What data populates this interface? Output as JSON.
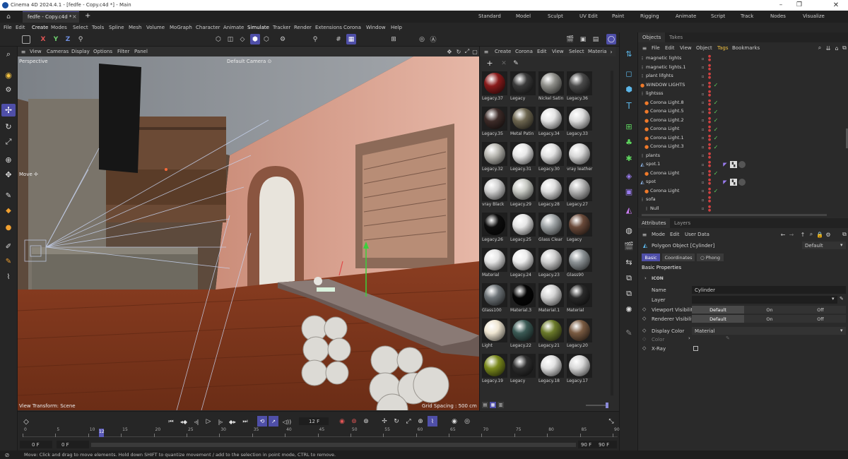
{
  "window": {
    "title": "Cinema 4D 2024.4.1 - [fedfe - Copy.c4d *] - Main"
  },
  "tabs": {
    "active": "fedfe - Copy.c4d *",
    "close": "×",
    "add": "+"
  },
  "layouts": [
    "Standard",
    "Model",
    "Sculpt",
    "UV Edit",
    "Paint",
    "Rigging",
    "Animate",
    "Script",
    "Track",
    "Nodes",
    "Visualize"
  ],
  "menu": [
    "File",
    "Edit",
    "Create",
    "Modes",
    "Select",
    "Tools",
    "Spline",
    "Mesh",
    "Volume",
    "MoGraph",
    "Character",
    "Animate",
    "Simulate",
    "Tracker",
    "Render",
    "Extensions",
    "Corona",
    "Window",
    "Help"
  ],
  "toolbar": {
    "x": "X",
    "y": "Y",
    "z": "Z"
  },
  "viewport": {
    "menu": [
      "View",
      "Cameras",
      "Display",
      "Options",
      "Filter",
      "Panel"
    ],
    "name": "Perspective",
    "camera": "Default Camera ⊙",
    "move_label": "Move ✢",
    "transform": "View Transform: Scene",
    "grid": "Grid Spacing : 500 cm"
  },
  "materials": {
    "menu": [
      "Create",
      "Corona",
      "Edit",
      "View",
      "Select",
      "Materia"
    ],
    "items": [
      {
        "label": "Legacy.37",
        "color": "#8a1b1b"
      },
      {
        "label": "Legacy",
        "color": "#3a3a3a"
      },
      {
        "label": "Nickel Satin",
        "color": "#8f8f8a"
      },
      {
        "label": "Legacy.36",
        "color": "#4a4a4a"
      },
      {
        "label": "Legacy.35",
        "color": "#3d2b28"
      },
      {
        "label": "Metal Patin",
        "color": "#6d6650"
      },
      {
        "label": "Legacy.34",
        "color": "#e4e4e4"
      },
      {
        "label": "Legacy.33",
        "color": "#dcdcdc"
      },
      {
        "label": "Legacy.32",
        "color": "#b9b8b2"
      },
      {
        "label": "Legacy.31",
        "color": "#e8e8e8"
      },
      {
        "label": "Legacy.30",
        "color": "#e2e2e2"
      },
      {
        "label": "vray leather",
        "color": "#d8d8d8"
      },
      {
        "label": "vray Black",
        "color": "#d0d0d0"
      },
      {
        "label": "Legacy.29",
        "color": "#c8cac4"
      },
      {
        "label": "Legacy.28",
        "color": "#dedede"
      },
      {
        "label": "Legacy.27",
        "color": "#b4b4b4"
      },
      {
        "label": "Legacy.26",
        "color": "#0d0d0d"
      },
      {
        "label": "Legacy.25",
        "color": "#e6e6e6"
      },
      {
        "label": "Glass Clear",
        "color": "#9fa4a6"
      },
      {
        "label": "Legacy",
        "color": "#6a4a3a"
      },
      {
        "label": "Material",
        "color": "#e4e4e4"
      },
      {
        "label": "Legacy.24",
        "color": "#ececec"
      },
      {
        "label": "Legacy.23",
        "color": "#cfcfcf"
      },
      {
        "label": "Glass90",
        "color": "#8d9396"
      },
      {
        "label": "Glass100",
        "color": "#6e7478"
      },
      {
        "label": "Material.3",
        "color": "#050505"
      },
      {
        "label": "Material.1",
        "color": "#d4d4d4"
      },
      {
        "label": "Material",
        "color": "#2a2a2a"
      },
      {
        "label": "Light",
        "color": "#efe6d2"
      },
      {
        "label": "Legacy.22",
        "color": "#3b5a55"
      },
      {
        "label": "Legacy.21",
        "color": "#6b7a2a"
      },
      {
        "label": "Legacy.20",
        "color": "#7a5b42"
      },
      {
        "label": "Legacy.19",
        "color": "#7b8a1d"
      },
      {
        "label": "Legacy",
        "color": "#2e2e2e"
      },
      {
        "label": "Legacy.18",
        "color": "#e2e2e2"
      },
      {
        "label": "Legacy.17",
        "color": "#d8d8d8"
      }
    ]
  },
  "objects": {
    "tabs": [
      "Objects",
      "Takes"
    ],
    "menu": [
      "File",
      "Edit",
      "View",
      "Object",
      "Tags",
      "Bookmarks"
    ],
    "rows": [
      {
        "name": "magnetic lights",
        "indent": 0,
        "icon": "null",
        "check": false
      },
      {
        "name": "magnetic lights.1",
        "indent": 0,
        "icon": "null",
        "check": false
      },
      {
        "name": "plant lifghts",
        "indent": 0,
        "icon": "null",
        "check": false
      },
      {
        "name": "WINDOW LIGHTS",
        "indent": 0,
        "icon": "light",
        "check": true
      },
      {
        "name": "lightsss",
        "indent": 0,
        "icon": "null",
        "check": false
      },
      {
        "name": "Corona Light.8",
        "indent": 1,
        "icon": "light",
        "check": true
      },
      {
        "name": "Corona Light.5",
        "indent": 1,
        "icon": "light",
        "check": true
      },
      {
        "name": "Corona Light.2",
        "indent": 1,
        "icon": "light",
        "check": true
      },
      {
        "name": "Corona Light",
        "indent": 1,
        "icon": "light",
        "check": true
      },
      {
        "name": "Corona Light.1",
        "indent": 1,
        "icon": "light",
        "check": true
      },
      {
        "name": "Corona Light.3",
        "indent": 1,
        "icon": "light",
        "check": true
      },
      {
        "name": "plants",
        "indent": 0,
        "icon": "null",
        "check": false
      },
      {
        "name": "spot.1",
        "indent": 0,
        "icon": "spot",
        "check": false
      },
      {
        "name": "Corona Light",
        "indent": 1,
        "icon": "light",
        "check": true
      },
      {
        "name": "spot",
        "indent": 0,
        "icon": "spot",
        "check": false
      },
      {
        "name": "Corona Light",
        "indent": 1,
        "icon": "light",
        "check": true
      },
      {
        "name": "sofa",
        "indent": 0,
        "icon": "null",
        "check": false
      },
      {
        "name": "Null",
        "indent": 1,
        "icon": "null",
        "check": false
      }
    ]
  },
  "attributes": {
    "tabs": [
      "Attributes",
      "Layers"
    ],
    "menu": [
      "Mode",
      "Edit",
      "User Data"
    ],
    "object_title": "Polygon Object [Cylinder]",
    "preset": "Default",
    "subtabs": [
      "Basic",
      "Coordinates",
      "Phong"
    ],
    "section": "Basic Properties",
    "icon_section": "ICON",
    "name_label": "Name",
    "name_value": "Cylinder",
    "layer_label": "Layer",
    "viewport_label": "Viewport Visibility",
    "renderer_label": "Renderer Visibility",
    "vis_options": [
      "Default",
      "On",
      "Off"
    ],
    "display_color_label": "Display Color",
    "display_color_value": "Material",
    "color_label": "Color",
    "xray_label": "X-Ray"
  },
  "timeline": {
    "ticks": [
      "0",
      "5",
      "10",
      "15",
      "20",
      "25",
      "30",
      "35",
      "40",
      "45",
      "50",
      "55",
      "60",
      "65",
      "70",
      "75",
      "80",
      "85",
      "90"
    ],
    "current_frame": "12 F",
    "playhead": "12",
    "start": "0 F",
    "start2": "0 F",
    "end": "90 F",
    "end2": "90 F"
  },
  "status": "Move: Click and drag to move elements. Hold down SHIFT to quantize movement / add to the selection in point mode, CTRL to remove."
}
